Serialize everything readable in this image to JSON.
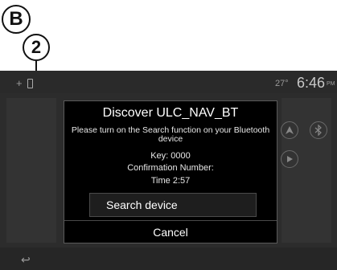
{
  "annotations": {
    "callout_b": "B",
    "callout_2": "2"
  },
  "status_bar": {
    "plus_icon_text": "+",
    "temperature": "27°",
    "clock": "6:46",
    "ampm": "PM"
  },
  "dialog": {
    "title": "Discover ULC_NAV_BT",
    "message": "Please turn on the Search function on  your Bluetooth device",
    "key_line": "Key: 0000",
    "confirmation_line": "Confirmation Number:",
    "time_line": "Time 2:57",
    "search_button_label": "Search device",
    "cancel_button_label": "Cancel"
  },
  "icons": {
    "phone": "phone-icon",
    "bluetooth": "bluetooth-icon",
    "navigation": "navigation-icon",
    "media": "play-icon",
    "back": "back-icon"
  },
  "bottom_bar": {
    "back_glyph": "↩"
  },
  "colors": {
    "screen_background": "#2c2c2c",
    "dialog_background": "#000000",
    "dialog_border": "#5a5a5a",
    "text": "#ffffff"
  }
}
